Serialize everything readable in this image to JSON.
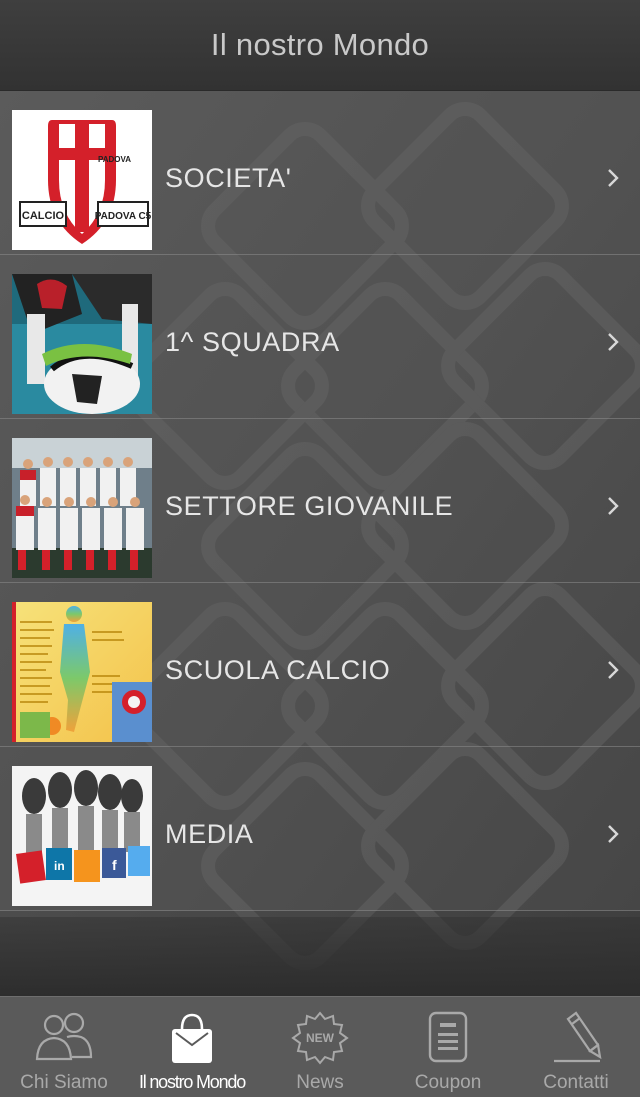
{
  "header": {
    "title": "Il nostro Mondo"
  },
  "menu": {
    "items": [
      {
        "label": "SOCIETA'",
        "icon": "club-logo-image",
        "logo_text_left": "CALCIO",
        "logo_text_right": "PADOVA C5",
        "logo_text_top": "PADOVA"
      },
      {
        "label": "1^ SQUADRA",
        "icon": "first-team-photo"
      },
      {
        "label": "SETTORE GIOVANILE",
        "icon": "youth-team-photo"
      },
      {
        "label": "SCUOLA CALCIO",
        "icon": "football-school-flyer"
      },
      {
        "label": "MEDIA",
        "icon": "media-microphones-image"
      }
    ]
  },
  "tabbar": {
    "items": [
      {
        "label": "Chi Siamo",
        "icon": "people-icon",
        "active": false
      },
      {
        "label": "Il nostro Mondo",
        "icon": "shopping-bag-icon",
        "active": true
      },
      {
        "label": "News",
        "icon": "new-badge-icon",
        "badge_text": "NEW",
        "active": false
      },
      {
        "label": "Coupon",
        "icon": "coupon-document-icon",
        "active": false
      },
      {
        "label": "Contatti",
        "icon": "pen-edit-icon",
        "active": false
      }
    ]
  },
  "colors": {
    "header_bg": "#383838",
    "content_bg": "#4a4a4a",
    "tabbar_bg": "#5a5a5a",
    "text_light": "#e6e6e6",
    "tab_inactive": "#a9a9a9",
    "tab_active": "#ffffff",
    "club_red": "#d4202a"
  }
}
